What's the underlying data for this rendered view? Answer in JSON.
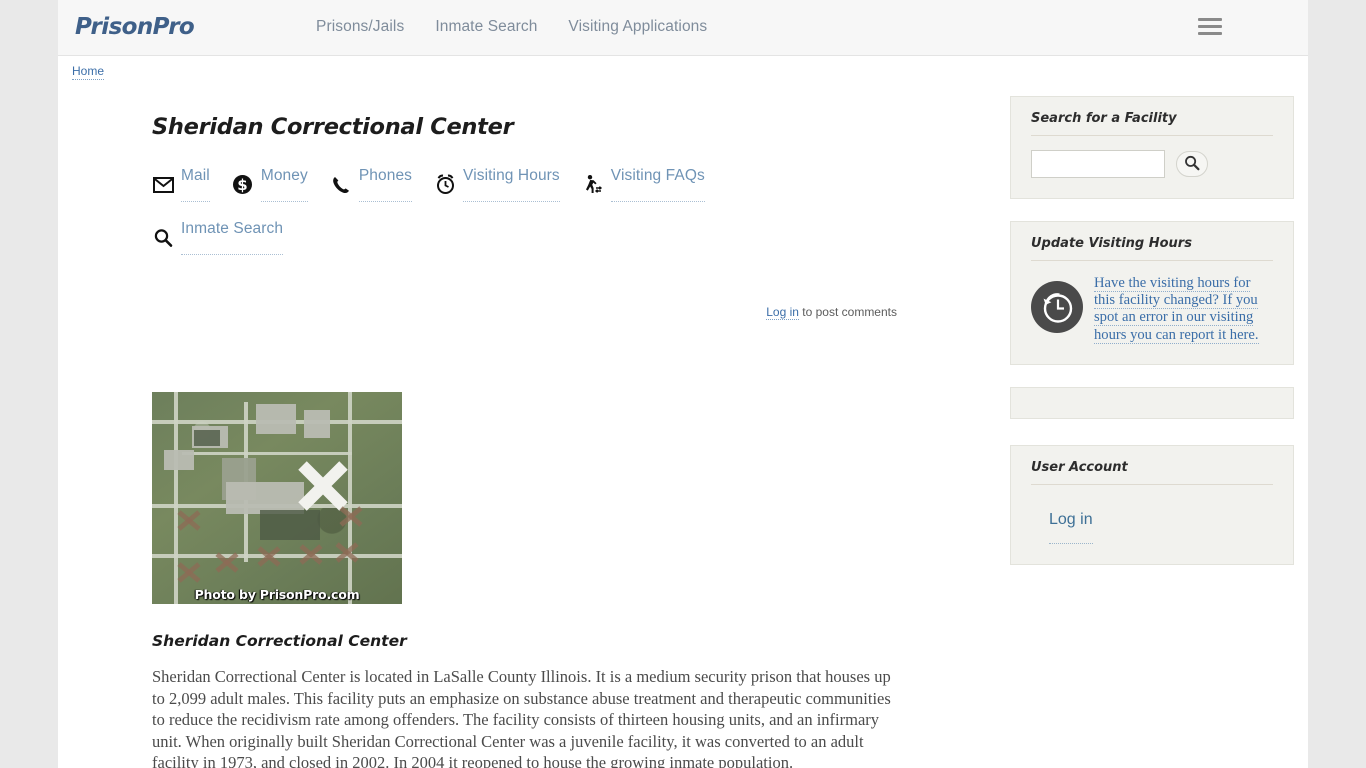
{
  "header": {
    "logo": "PrisonPro",
    "nav": [
      {
        "label": "Prisons/Jails"
      },
      {
        "label": "Inmate Search"
      },
      {
        "label": "Visiting Applications"
      }
    ],
    "menu_icon": "hamburger-menu-icon"
  },
  "breadcrumb": {
    "home": "Home"
  },
  "main": {
    "page_title": "Sheridan Correctional Center",
    "quick_links": [
      {
        "label": "Mail",
        "icon": "envelope-icon"
      },
      {
        "label": "Money",
        "icon": "dollar-circle-icon"
      },
      {
        "label": "Phones",
        "icon": "phone-icon"
      },
      {
        "label": "Visiting Hours",
        "icon": "alarm-clock-icon"
      },
      {
        "label": "Visiting FAQs",
        "icon": "walking-person-icon"
      },
      {
        "label": "Inmate Search",
        "icon": "magnifier-icon"
      }
    ],
    "comments": {
      "login_label": "Log in",
      "rest": " to post comments"
    },
    "photo": {
      "credit": "Photo by PrisonPro.com",
      "alt": "aerial-satellite-view-of-prison"
    },
    "body_heading": "Sheridan Correctional Center",
    "body_text": "Sheridan Correctional Center is located in LaSalle County Illinois.  It is a medium security prison that houses up to 2,099 adult males.  This facility puts an emphasize on substance abuse treatment and therapeutic communities to reduce the recidivism rate among offenders.  The facility consists of thirteen housing units, and an infirmary unit.  When originally built Sheridan Correctional Center was a juvenile facility, it was converted to an adult facility in 1973, and closed in 2002.  In 2004 it reopened to house the growing inmate population."
  },
  "sidebar": {
    "search_block": {
      "title": "Search for a Facility",
      "input_value": "",
      "input_placeholder": "",
      "button_icon": "magnifier-icon"
    },
    "update_block": {
      "title": "Update Visiting Hours",
      "icon": "clock-history-icon",
      "link_text": "Have the visiting hours for this facility changed?  If you spot an error in our visiting hours you can report it here."
    },
    "account_block": {
      "title": "User Account",
      "login_label": "Log in"
    }
  },
  "colors": {
    "page_bg": "#e9e9e9",
    "content_bg": "#ffffff",
    "header_bg": "#f7f7f7",
    "logo": "#3f6089",
    "nav_text": "#7f8c9b",
    "link_blue": "#3b6ea8",
    "quick_link": "#6f93b5",
    "sidebar_bg": "#f2f2ee",
    "body_text": "#4b4b4b"
  }
}
